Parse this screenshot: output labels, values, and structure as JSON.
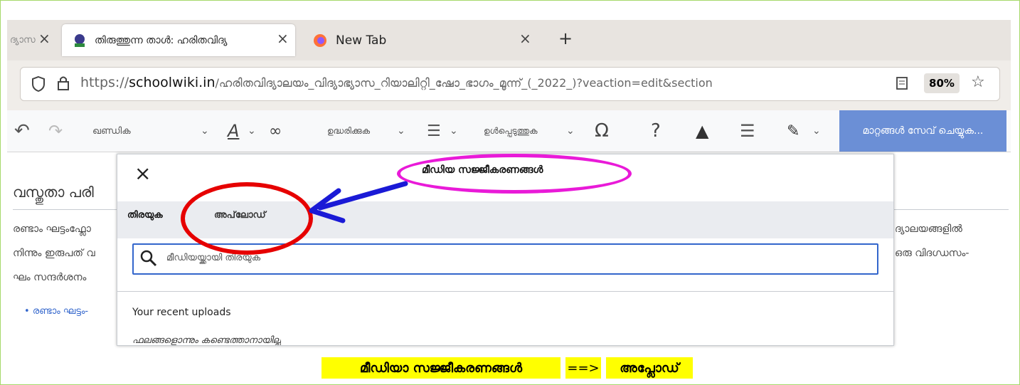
{
  "browser": {
    "tabs": [
      {
        "title": "ദ്യാസ",
        "close": "×"
      },
      {
        "title": "തിരുത്തുന്ന താൾ: ഹരിതവിദ്യ",
        "close": "×"
      },
      {
        "title": "New Tab",
        "close": "×"
      }
    ],
    "new_tab": "+",
    "url_prefix": "https://",
    "url_domain": "schoolwiki.in",
    "url_path": "/ഹരിതവിദ്യാലയം_വിദ്യാഭ്യാസ_റിയാലിറ്റി_ഷോ_ഭാഗം_മൂന്ന്_(_2022_)?veaction=edit&section",
    "zoom": "80%"
  },
  "editor_toolbar": {
    "paragraph": "ഖണ്ഡിക",
    "cite": "ഉദ്ധരിക്കുക",
    "insert": "ഉൾപ്പെടുത്തുക",
    "special_char": "Ω",
    "help": "?",
    "save": "മാറ്റങ്ങൾ സേവ് ചെയ്യുക..."
  },
  "page": {
    "heading": "വസ്തുതാ പരി",
    "lines": [
      "രണ്ടാം ഘട്ടംഫ്ലോ",
      "നിന്നും ഇരുപത് വ",
      "ഘം സന്ദർശനം"
    ],
    "right_lines": [
      "ദ്യാലയങ്ങളിൽ",
      "ഒരു വിദഗ്ധസം-"
    ],
    "bullet": "രണ്ടാം ഘട്ടം-"
  },
  "dialog": {
    "title": "മീഡിയ സജ്ജീകരണങ്ങൾ",
    "close": "×",
    "tab_search": "തിരയുക",
    "tab_upload": "അപ്‌ലോഡ്",
    "search_placeholder": "മീഡിയയ്ക്കായി തിരയുക",
    "recent_uploads": "Your recent uploads",
    "no_results": "ഫലങ്ങളൊന്നും കണ്ടെത്താനായില്ല"
  },
  "caption": {
    "part1": "മീഡിയാ സജ്ജീകരണങ്ങൾ",
    "arrow": "==>",
    "part2": "അപ്ലോഡ്"
  },
  "colors": {
    "save_button": "#6b8fd6",
    "ellipse_magenta": "#e91ad8",
    "ellipse_red": "#e60000",
    "arrow_blue": "#1a1ad6",
    "highlight": "#ffff00"
  }
}
